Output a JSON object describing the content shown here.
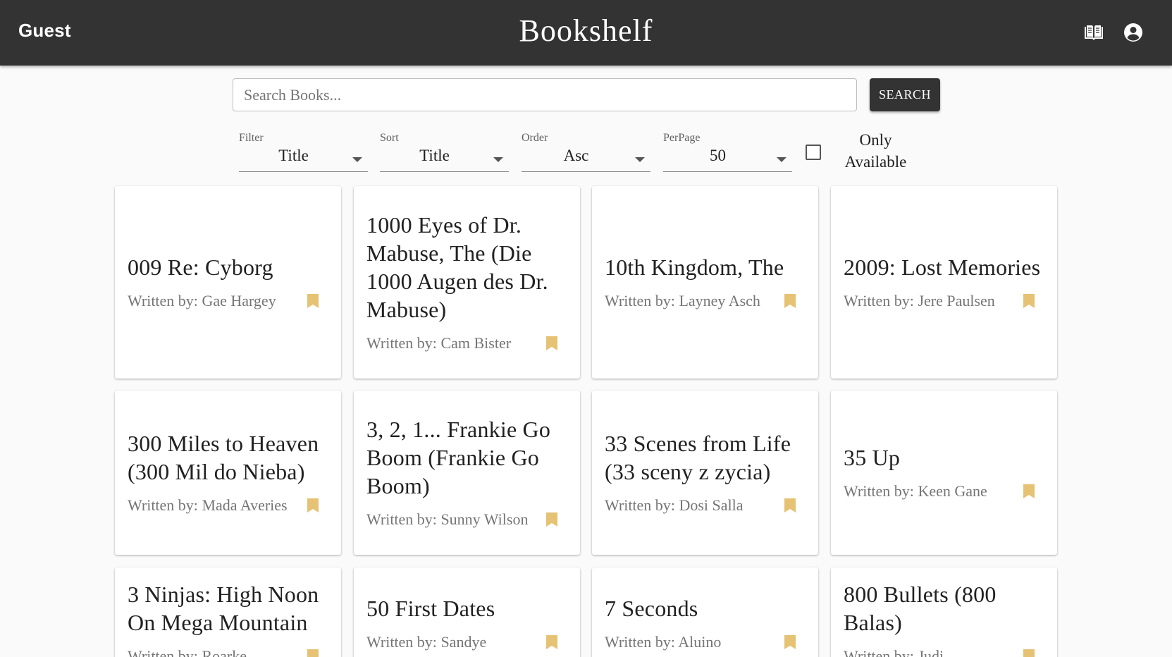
{
  "appbar": {
    "user": "Guest",
    "title": "Bookshelf",
    "icons": [
      "book-icon",
      "account-circle-icon"
    ]
  },
  "search": {
    "placeholder": "Search Books...",
    "value": "",
    "button_label": "SEARCH"
  },
  "controls": {
    "filter": {
      "label": "Filter",
      "value": "Title"
    },
    "sort": {
      "label": "Sort",
      "value": "Title"
    },
    "order": {
      "label": "Order",
      "value": "Asc"
    },
    "perpage": {
      "label": "PerPage",
      "value": "50"
    },
    "only_available": {
      "label_line1": "Only",
      "label_line2": "Available",
      "checked": false
    }
  },
  "colors": {
    "appbar": "#333333",
    "bookmark": "#e6c274",
    "author_text": "#757575"
  },
  "books": [
    {
      "title": "009 Re: Cyborg",
      "author_prefix": "Written by:",
      "author": "Gae Hargey"
    },
    {
      "title": "1000 Eyes of Dr. Mabuse, The (Die 1000 Augen des Dr. Mabuse)",
      "author_prefix": "Written by:",
      "author": "Cam Bister"
    },
    {
      "title": "10th Kingdom, The",
      "author_prefix": "Written by:",
      "author": "Layney Asch"
    },
    {
      "title": "2009: Lost Memories",
      "author_prefix": "Written by:",
      "author": "Jere Paulsen"
    },
    {
      "title": "300 Miles to Heaven (300 Mil do Nieba)",
      "author_prefix": "Written by:",
      "author": "Mada Averies"
    },
    {
      "title": "3, 2, 1... Frankie Go Boom (Frankie Go Boom)",
      "author_prefix": "Written by:",
      "author": "Sunny Wilson"
    },
    {
      "title": "33 Scenes from Life (33 sceny z zycia)",
      "author_prefix": "Written by:",
      "author": "Dosi Salla"
    },
    {
      "title": "35 Up",
      "author_prefix": "Written by:",
      "author": "Keen Gane"
    },
    {
      "title": "3 Ninjas: High Noon On Mega Mountain",
      "author_prefix": "Written by:",
      "author": "Roarke"
    },
    {
      "title": "50 First Dates",
      "author_prefix": "Written by:",
      "author": "Sandye"
    },
    {
      "title": "7 Seconds",
      "author_prefix": "Written by:",
      "author": "Aluino"
    },
    {
      "title": "800 Bullets (800 Balas)",
      "author_prefix": "Written by:",
      "author": "Judi"
    }
  ]
}
